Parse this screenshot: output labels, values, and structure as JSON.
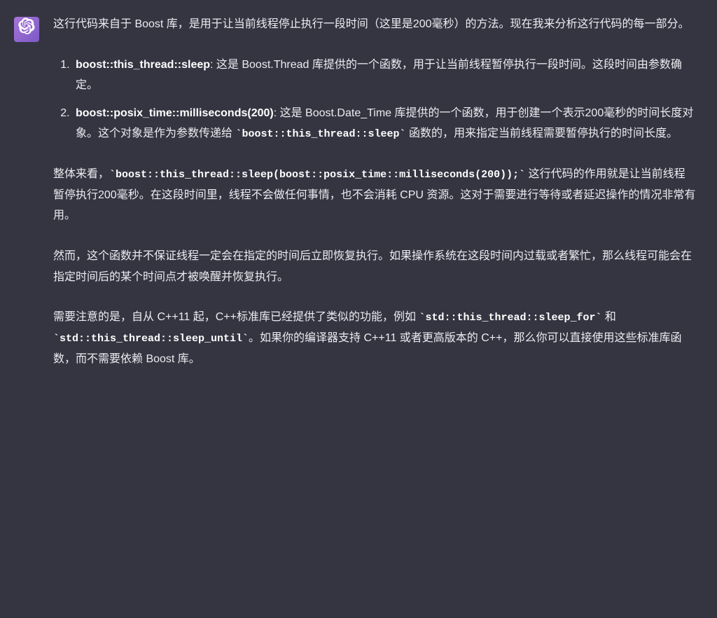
{
  "message": {
    "intro": "这行代码来自于 Boost 库，是用于让当前线程停止执行一段时间（这里是200毫秒）的方法。现在我来分析这行代码的每一部分。",
    "list": [
      {
        "term": "boost::this_thread::sleep",
        "desc": ": 这是 Boost.Thread 库提供的一个函数，用于让当前线程暂停执行一段时间。这段时间由参数确定。"
      },
      {
        "term": "boost::posix_time::milliseconds(200)",
        "desc_before": ": 这是 Boost.Date_Time 库提供的一个函数，用于创建一个表示200毫秒的时间长度对象。这个对象是作为参数传递给 ",
        "code": "`boost::this_thread::sleep`",
        "desc_after": " 函数的，用来指定当前线程需要暂停执行的时间长度。"
      }
    ],
    "para2_prefix": "整体来看，",
    "para2_code": "`boost::this_thread::sleep(boost::posix_time::milliseconds(200));`",
    "para2_suffix": " 这行代码的作用就是让当前线程暂停执行200毫秒。在这段时间里，线程不会做任何事情，也不会消耗 CPU 资源。这对于需要进行等待或者延迟操作的情况非常有用。",
    "para3": "然而，这个函数并不保证线程一定会在指定的时间后立即恢复执行。如果操作系统在这段时间内过载或者繁忙，那么线程可能会在指定时间后的某个时间点才被唤醒并恢复执行。",
    "para4_prefix": "需要注意的是，自从 C++11 起，C++标准库已经提供了类似的功能，例如 ",
    "para4_code1": "`std::this_thread::sleep_for`",
    "para4_mid": " 和 ",
    "para4_code2": "`std::this_thread::sleep_until`",
    "para4_suffix": "。如果你的编译器支持 C++11 或者更高版本的 C++，那么你可以直接使用这些标准库函数，而不需要依赖 Boost 库。"
  }
}
